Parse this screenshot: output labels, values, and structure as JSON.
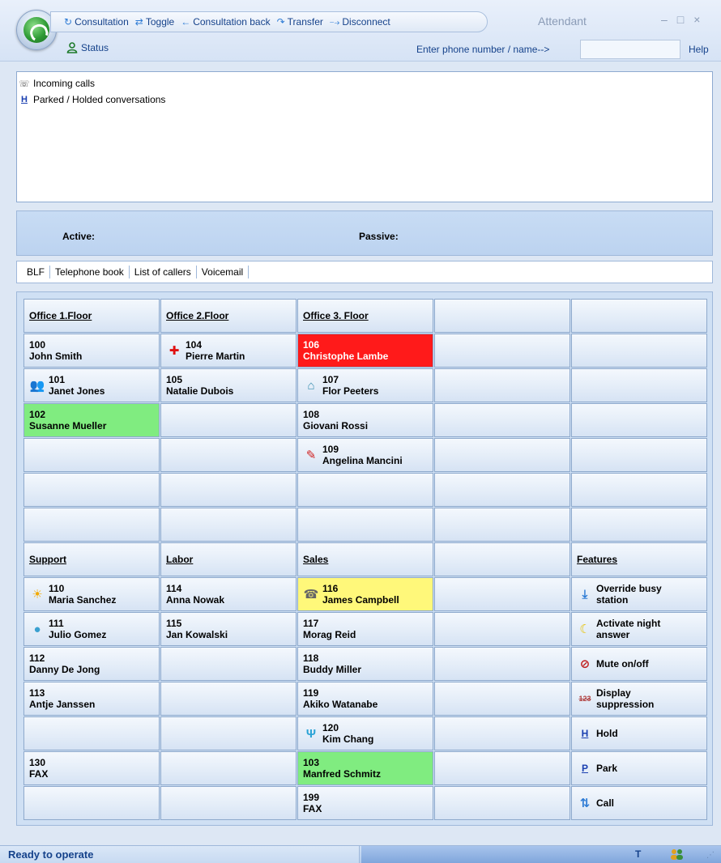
{
  "window": {
    "title": "Attendant",
    "controls": [
      "–",
      "□",
      "×"
    ]
  },
  "toolbar": {
    "items": [
      {
        "label": "Consultation",
        "icon": "consultation-icon",
        "glyph": "↻"
      },
      {
        "label": "Toggle",
        "icon": "toggle-icon",
        "glyph": "⇄"
      },
      {
        "label": "Consultation back",
        "icon": "consultation-back-icon",
        "glyph": "←"
      },
      {
        "label": "Transfer",
        "icon": "transfer-icon",
        "glyph": "↷"
      },
      {
        "label": "Disconnect",
        "icon": "disconnect-icon",
        "glyph": "⤍"
      }
    ],
    "status_label": "Status",
    "phone_prompt": "Enter phone number / name-->",
    "phone_value": "",
    "help_label": "Help"
  },
  "call_list": {
    "rows": [
      {
        "label": "Incoming calls",
        "icon": "incoming-calls-icon"
      },
      {
        "label": "Parked / Holded conversations",
        "icon": "parked-icon"
      }
    ]
  },
  "active_bar": {
    "active_label": "Active:",
    "passive_label": "Passive:"
  },
  "tabs": [
    "BLF",
    "Telephone book",
    "List of callers",
    "Voicemail"
  ],
  "blf": {
    "rows": [
      [
        {
          "kind": "header",
          "text": "Office 1.Floor"
        },
        {
          "kind": "header",
          "text": "Office 2.Floor"
        },
        {
          "kind": "header",
          "text": "Office 3. Floor"
        },
        {
          "kind": "empty"
        },
        {
          "kind": "empty"
        }
      ],
      [
        {
          "kind": "ext",
          "num": "100",
          "name": "John Smith"
        },
        {
          "kind": "ext",
          "num": "104",
          "name": "Pierre Martin",
          "icon": "red-cross-icon"
        },
        {
          "kind": "ext",
          "num": "106",
          "name": "Christophe Lambe",
          "state": "red"
        },
        {
          "kind": "empty"
        },
        {
          "kind": "empty"
        }
      ],
      [
        {
          "kind": "ext",
          "num": "101",
          "name": "Janet Jones",
          "icon": "people-icon"
        },
        {
          "kind": "ext",
          "num": "105",
          "name": "Natalie Dubois"
        },
        {
          "kind": "ext",
          "num": "107",
          "name": "Flor Peeters",
          "icon": "house-icon"
        },
        {
          "kind": "empty"
        },
        {
          "kind": "empty"
        }
      ],
      [
        {
          "kind": "ext",
          "num": "102",
          "name": "Susanne Mueller",
          "state": "green"
        },
        {
          "kind": "empty"
        },
        {
          "kind": "ext",
          "num": "108",
          "name": "Giovani Rossi"
        },
        {
          "kind": "empty"
        },
        {
          "kind": "empty"
        }
      ],
      [
        {
          "kind": "empty"
        },
        {
          "kind": "empty"
        },
        {
          "kind": "ext",
          "num": "109",
          "name": "Angelina Mancini",
          "icon": "pen-icon"
        },
        {
          "kind": "empty"
        },
        {
          "kind": "empty"
        }
      ],
      [
        {
          "kind": "empty"
        },
        {
          "kind": "empty"
        },
        {
          "kind": "empty"
        },
        {
          "kind": "empty"
        },
        {
          "kind": "empty"
        }
      ],
      [
        {
          "kind": "empty"
        },
        {
          "kind": "empty"
        },
        {
          "kind": "empty"
        },
        {
          "kind": "empty"
        },
        {
          "kind": "empty"
        }
      ],
      [
        {
          "kind": "header",
          "text": "Support"
        },
        {
          "kind": "header",
          "text": "Labor"
        },
        {
          "kind": "header",
          "text": "Sales"
        },
        {
          "kind": "empty"
        },
        {
          "kind": "header",
          "text": "Features"
        }
      ],
      [
        {
          "kind": "ext",
          "num": "110",
          "name": "Maria Sanchez",
          "icon": "sun-icon"
        },
        {
          "kind": "ext",
          "num": "114",
          "name": "Anna Nowak"
        },
        {
          "kind": "ext",
          "num": "116",
          "name": "James Campbell",
          "icon": "ringing-phone-icon",
          "state": "yellow"
        },
        {
          "kind": "empty"
        },
        {
          "kind": "feature",
          "line1": "Override busy",
          "line2": "station",
          "icon": "override-icon"
        }
      ],
      [
        {
          "kind": "ext",
          "num": "111",
          "name": "Julio Gomez",
          "icon": "globe-icon"
        },
        {
          "kind": "ext",
          "num": "115",
          "name": "Jan Kowalski"
        },
        {
          "kind": "ext",
          "num": "117",
          "name": "Morag Reid"
        },
        {
          "kind": "empty"
        },
        {
          "kind": "feature",
          "line1": "Activate night",
          "line2": "answer",
          "icon": "moon-icon"
        }
      ],
      [
        {
          "kind": "ext",
          "num": "112",
          "name": "Danny De Jong"
        },
        {
          "kind": "empty"
        },
        {
          "kind": "ext",
          "num": "118",
          "name": "Buddy Miller"
        },
        {
          "kind": "empty"
        },
        {
          "kind": "feature",
          "line1": "Mute on/off",
          "line2": "",
          "icon": "mute-icon"
        }
      ],
      [
        {
          "kind": "ext",
          "num": "113",
          "name": "Antje Janssen"
        },
        {
          "kind": "empty"
        },
        {
          "kind": "ext",
          "num": "119",
          "name": "Akiko Watanabe"
        },
        {
          "kind": "empty"
        },
        {
          "kind": "feature",
          "line1": "Display",
          "line2": "suppression",
          "icon": "display-suppression-icon"
        }
      ],
      [
        {
          "kind": "empty"
        },
        {
          "kind": "empty"
        },
        {
          "kind": "ext",
          "num": "120",
          "name": "Kim Chang",
          "icon": "cutlery-icon"
        },
        {
          "kind": "empty"
        },
        {
          "kind": "feature",
          "line1": "Hold",
          "line2": "",
          "icon": "hold-icon"
        }
      ],
      [
        {
          "kind": "ext",
          "num": "130",
          "name": "FAX"
        },
        {
          "kind": "empty"
        },
        {
          "kind": "ext",
          "num": "103",
          "name": "Manfred Schmitz",
          "state": "green"
        },
        {
          "kind": "empty"
        },
        {
          "kind": "feature",
          "line1": "Park",
          "line2": "",
          "icon": "park-icon"
        }
      ],
      [
        {
          "kind": "empty"
        },
        {
          "kind": "empty"
        },
        {
          "kind": "ext",
          "num": "199",
          "name": "FAX"
        },
        {
          "kind": "empty"
        },
        {
          "kind": "feature",
          "line1": "Call",
          "line2": "",
          "icon": "call-icon"
        }
      ]
    ]
  },
  "icon_glyphs": {
    "red-cross-icon": "✚",
    "people-icon": "👥",
    "house-icon": "⌂",
    "pen-icon": "✎",
    "sun-icon": "☀",
    "ringing-phone-icon": "☎",
    "globe-icon": "●",
    "cutlery-icon": "Ψ",
    "override-icon": "⤓",
    "moon-icon": "☾",
    "mute-icon": "⊘",
    "display-suppression-icon": "123",
    "hold-icon": "H",
    "park-icon": "P",
    "call-icon": "⇅",
    "incoming-calls-icon": "☏",
    "parked-icon": "H"
  },
  "icon_colors": {
    "red-cross-icon": "#e01010",
    "people-icon": "#2b8fd8",
    "house-icon": "#3a8fb0",
    "pen-icon": "#d02020",
    "sun-icon": "#f2a900",
    "ringing-phone-icon": "#666666",
    "globe-icon": "#3aa0d0",
    "cutlery-icon": "#2aa3d6",
    "override-icon": "#2d7bd5",
    "moon-icon": "#e8c200",
    "mute-icon": "#c02020",
    "display-suppression-icon": "#b04040",
    "hold-icon": "#1a3fb0",
    "park-icon": "#1a3fb0",
    "call-icon": "#2d7bd5",
    "incoming-calls-icon": "#555555",
    "parked-icon": "#1a3fb0"
  },
  "state_colors": {
    "red": "#ff1a1a",
    "green": "#80ec80",
    "yellow": "#fff87a"
  },
  "statusbar": {
    "text": "Ready to operate",
    "indicator": "T",
    "users_icon": "users-icon"
  }
}
